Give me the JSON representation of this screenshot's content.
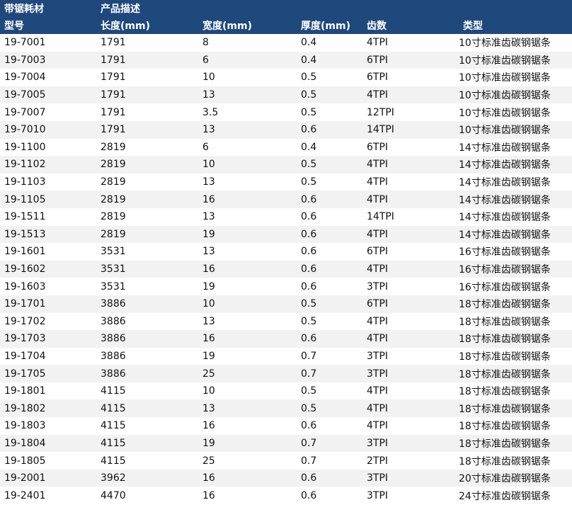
{
  "header": {
    "group1": "带锯耗材",
    "group2": "产品描述",
    "columns": [
      "型号",
      "长度(mm)",
      "宽度(mm)",
      "厚度(mm)",
      "齿数",
      "类型"
    ]
  },
  "rows": [
    [
      "19-7001",
      "1791",
      "8",
      "0.4",
      "4TPI",
      "10寸标准齿碳钢锯条"
    ],
    [
      "19-7003",
      "1791",
      "6",
      "0.4",
      "6TPI",
      "10寸标准齿碳钢锯条"
    ],
    [
      "19-7004",
      "1791",
      "10",
      "0.5",
      "6TPI",
      "10寸标准齿碳钢锯条"
    ],
    [
      "19-7005",
      "1791",
      "13",
      "0.5",
      "4TPI",
      "10寸标准齿碳钢锯条"
    ],
    [
      "19-7007",
      "1791",
      "3.5",
      "0.5",
      "12TPI",
      "10寸标准齿碳钢锯条"
    ],
    [
      "19-7010",
      "1791",
      "13",
      "0.6",
      "14TPI",
      "10寸标准齿碳钢锯条"
    ],
    [
      "19-1100",
      "2819",
      "6",
      "0.4",
      "6TPI",
      "14寸标准齿碳钢锯条"
    ],
    [
      "19-1102",
      "2819",
      "10",
      "0.5",
      "4TPI",
      "14寸标准齿碳钢锯条"
    ],
    [
      "19-1103",
      "2819",
      "13",
      "0.5",
      "4TPI",
      "14寸标准齿碳钢锯条"
    ],
    [
      "19-1105",
      "2819",
      "16",
      "0.6",
      "4TPI",
      "14寸标准齿碳钢锯条"
    ],
    [
      "19-1511",
      "2819",
      "13",
      "0.6",
      "14TPI",
      "14寸标准齿碳钢锯条"
    ],
    [
      "19-1513",
      "2819",
      "19",
      "0.6",
      "4TPI",
      "14寸标准齿碳钢锯条"
    ],
    [
      "19-1601",
      "3531",
      "13",
      "0.6",
      "6TPI",
      "16寸标准齿碳钢锯条"
    ],
    [
      "19-1602",
      "3531",
      "16",
      "0.6",
      "4TPI",
      "16寸标准齿碳钢锯条"
    ],
    [
      "19-1603",
      "3531",
      "19",
      "0.6",
      "3TPI",
      "16寸标准齿碳钢锯条"
    ],
    [
      "19-1701",
      "3886",
      "10",
      "0.5",
      "6TPI",
      "18寸标准齿碳钢锯条"
    ],
    [
      "19-1702",
      "3886",
      "13",
      "0.5",
      "4TPI",
      "18寸标准齿碳钢锯条"
    ],
    [
      "19-1703",
      "3886",
      "16",
      "0.6",
      "4TPI",
      "18寸标准齿碳钢锯条"
    ],
    [
      "19-1704",
      "3886",
      "19",
      "0.7",
      "3TPI",
      "18寸标准齿碳钢锯条"
    ],
    [
      "19-1705",
      "3886",
      "25",
      "0.7",
      "3TPI",
      "18寸标准齿碳钢锯条"
    ],
    [
      "19-1801",
      "4115",
      "10",
      "0.5",
      "4TPI",
      "18寸标准齿碳钢锯条"
    ],
    [
      "19-1802",
      "4115",
      "13",
      "0.5",
      "4TPI",
      "18寸标准齿碳钢锯条"
    ],
    [
      "19-1803",
      "4115",
      "16",
      "0.6",
      "4TPI",
      "18寸标准齿碳钢锯条"
    ],
    [
      "19-1804",
      "4115",
      "19",
      "0.7",
      "3TPI",
      "18寸标准齿碳钢锯条"
    ],
    [
      "19-1805",
      "4115",
      "25",
      "0.7",
      "2TPI",
      "18寸标准齿碳钢锯条"
    ],
    [
      "19-2001",
      "3962",
      "16",
      "0.6",
      "3TPI",
      "20寸标准齿碳钢锯条"
    ],
    [
      "19-2401",
      "4470",
      "16",
      "0.6",
      "3TPI",
      "24寸标准齿碳钢锯条"
    ]
  ],
  "colors": {
    "header_bg": "#1f497d",
    "header_text": "#ffffff",
    "row_alt_bg": "#f2f2f2"
  }
}
